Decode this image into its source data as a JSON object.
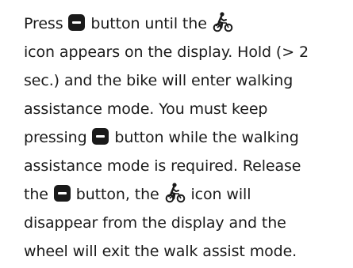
{
  "instructions": {
    "line1_a": "Press ",
    "line1_b": " button until the ",
    "line2": "icon appears on the display. Hold (> 2",
    "line3": "sec.) and the bike will enter walking",
    "line4": "assistance mode. You must keep",
    "line5_a": "pressing ",
    "line5_b": " button while the walking",
    "line6": "assistance mode is required. Release",
    "line7_a": "the ",
    "line7_b": " button, the ",
    "line7_c": " icon will",
    "line8": "disappear from the display and the",
    "line9": "wheel will exit the walk assist mode."
  },
  "icons": {
    "minus_button": "minus-button-icon",
    "walk_assist": "walking-bike-icon"
  },
  "colors": {
    "text": "#1a1a1a",
    "background": "#ffffff"
  }
}
